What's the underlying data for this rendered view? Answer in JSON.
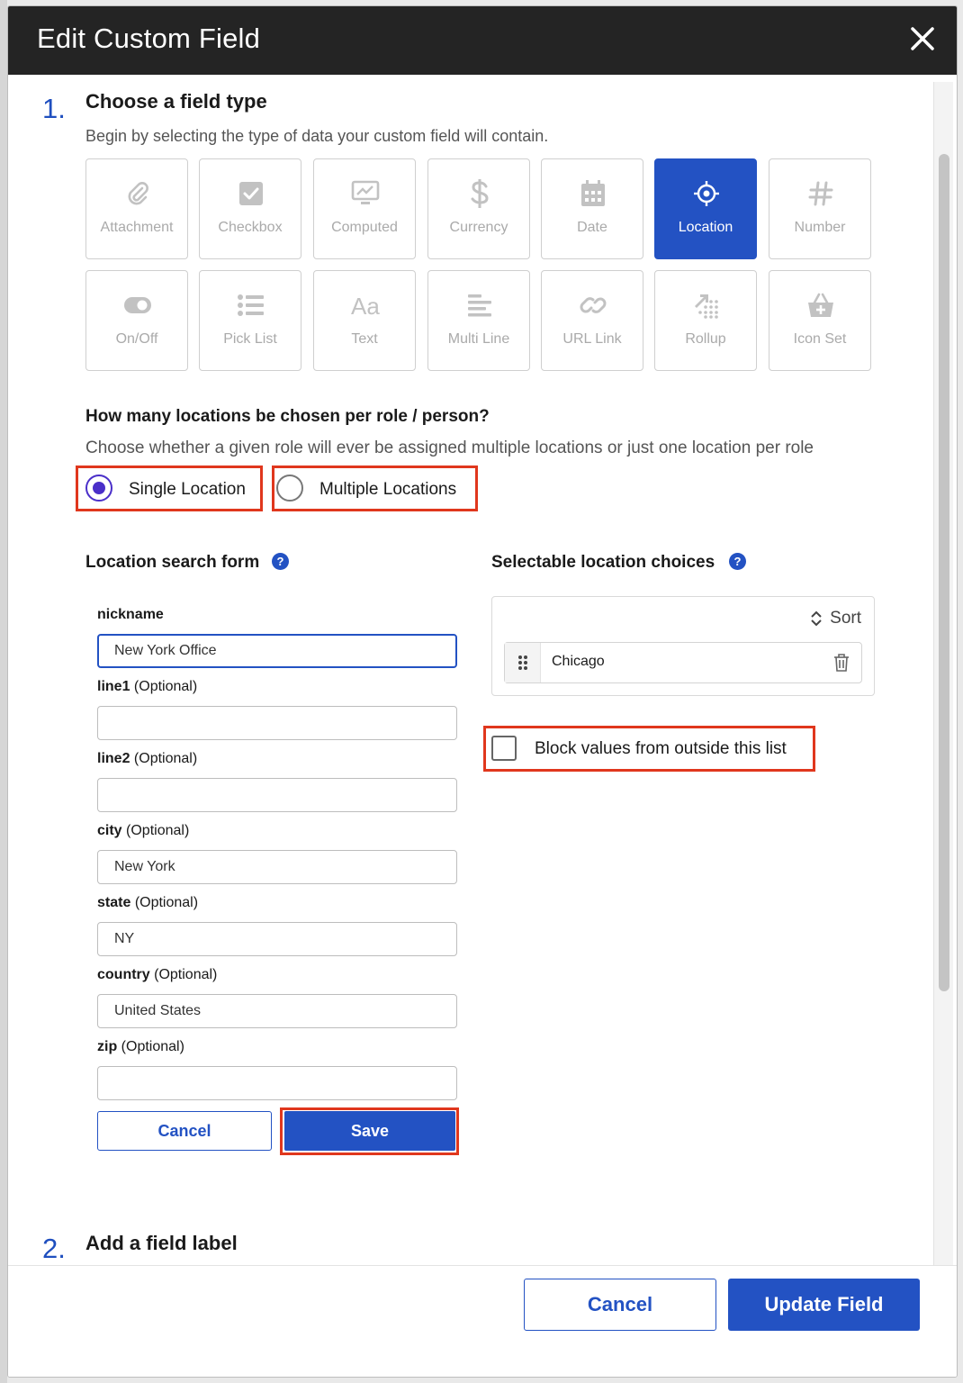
{
  "modal": {
    "title": "Edit Custom Field"
  },
  "step1": {
    "number": "1.",
    "title": "Choose a field type",
    "description": "Begin by selecting the type of data your custom field will contain.",
    "types": [
      {
        "label": "Attachment",
        "icon": "paperclip-icon",
        "active": false
      },
      {
        "label": "Checkbox",
        "icon": "checkbox-icon",
        "active": false
      },
      {
        "label": "Computed",
        "icon": "monitor-chart-icon",
        "active": false
      },
      {
        "label": "Currency",
        "icon": "dollar-icon",
        "active": false
      },
      {
        "label": "Date",
        "icon": "calendar-icon",
        "active": false
      },
      {
        "label": "Location",
        "icon": "crosshair-icon",
        "active": true
      },
      {
        "label": "Number",
        "icon": "hash-icon",
        "active": false
      },
      {
        "label": "On/Off",
        "icon": "toggle-icon",
        "active": false
      },
      {
        "label": "Pick List",
        "icon": "list-icon",
        "active": false
      },
      {
        "label": "Text",
        "icon": "text-aa-icon",
        "active": false
      },
      {
        "label": "Multi Line",
        "icon": "multiline-icon",
        "active": false
      },
      {
        "label": "URL Link",
        "icon": "link-icon",
        "active": false
      },
      {
        "label": "Rollup",
        "icon": "rollup-icon",
        "active": false
      },
      {
        "label": "Icon Set",
        "icon": "basket-icon",
        "active": false
      }
    ]
  },
  "locations_question": {
    "title": "How many locations be chosen per role / person?",
    "description": "Choose whether a given role will ever be assigned multiple locations or just one location per role",
    "options": [
      {
        "label": "Single Location",
        "checked": true
      },
      {
        "label": "Multiple Locations",
        "checked": false
      }
    ]
  },
  "search_form": {
    "title": "Location search form",
    "help": "?",
    "optional_text": "(Optional)",
    "fields": [
      {
        "name": "nickname",
        "optional": "",
        "value": "New York Office"
      },
      {
        "name": "line1",
        "optional": "(Optional)",
        "value": ""
      },
      {
        "name": "line2",
        "optional": "(Optional)",
        "value": ""
      },
      {
        "name": "city",
        "optional": "(Optional)",
        "value": "New York"
      },
      {
        "name": "state",
        "optional": "(Optional)",
        "value": "NY"
      },
      {
        "name": "country",
        "optional": "(Optional)",
        "value": "United States"
      },
      {
        "name": "zip",
        "optional": "(Optional)",
        "value": ""
      }
    ],
    "cancel_label": "Cancel",
    "save_label": "Save"
  },
  "choices": {
    "title": "Selectable location choices",
    "help": "?",
    "sort_label": "Sort",
    "items": [
      {
        "label": "Chicago"
      }
    ],
    "block_label": "Block values from outside this list",
    "block_checked": false
  },
  "step2": {
    "number": "2.",
    "title": "Add a field label"
  },
  "footer": {
    "cancel_label": "Cancel",
    "update_label": "Update Field"
  },
  "colors": {
    "accent": "#2352c3",
    "highlight": "#e0371d",
    "radio": "#4a2fc9",
    "header": "#242424"
  }
}
